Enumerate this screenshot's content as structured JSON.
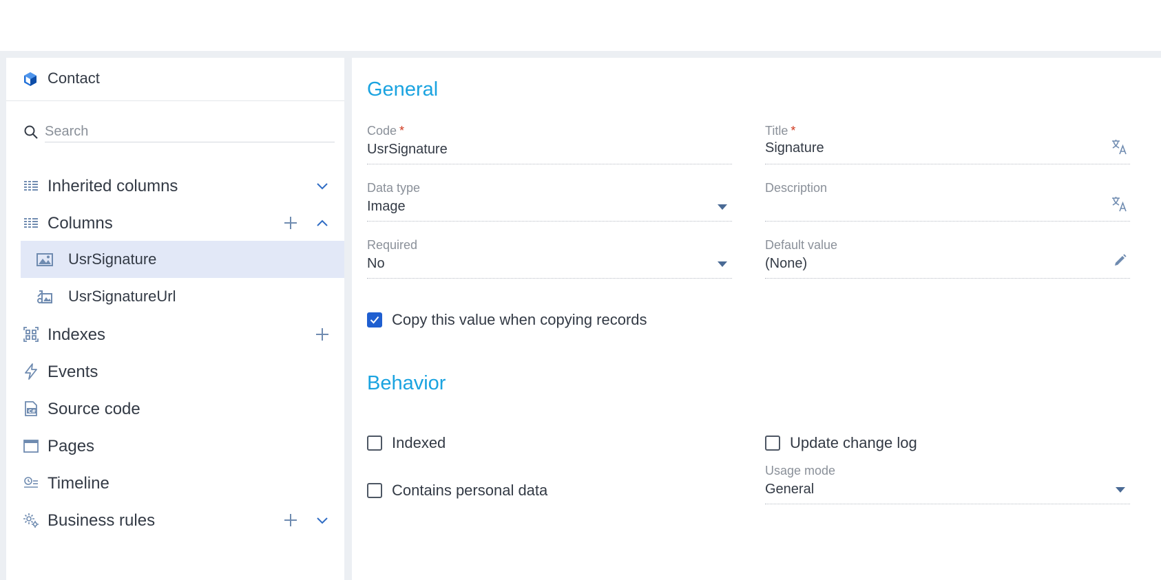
{
  "object": {
    "name": "Contact",
    "icon": "cube-icon"
  },
  "search": {
    "placeholder": "Search"
  },
  "nav": {
    "inherited_columns": "Inherited columns",
    "columns": "Columns",
    "column_items": [
      {
        "label": "UsrSignature",
        "icon": "image-icon",
        "selected": true
      },
      {
        "label": "UsrSignatureUrl",
        "icon": "image-link-icon",
        "selected": false
      }
    ],
    "indexes": "Indexes",
    "events": "Events",
    "source_code": "Source code",
    "pages": "Pages",
    "timeline": "Timeline",
    "business_rules": "Business rules"
  },
  "general": {
    "heading": "General",
    "code": {
      "label": "Code",
      "value": "UsrSignature",
      "required_mark": "*"
    },
    "title": {
      "label": "Title",
      "value": "Signature",
      "required_mark": "*"
    },
    "data_type": {
      "label": "Data type",
      "value": "Image"
    },
    "description": {
      "label": "Description",
      "value": ""
    },
    "required": {
      "label": "Required",
      "value": "No"
    },
    "default_value": {
      "label": "Default value",
      "value": "(None)"
    },
    "copy_value": {
      "label": "Copy this value when copying records",
      "checked": true
    }
  },
  "behavior": {
    "heading": "Behavior",
    "indexed": {
      "label": "Indexed",
      "checked": false
    },
    "update_change_log": {
      "label": "Update change log",
      "checked": false
    },
    "contains_personal_data": {
      "label": "Contains personal data",
      "checked": false
    },
    "usage_mode": {
      "label": "Usage mode",
      "value": "General"
    }
  },
  "colors": {
    "accent": "#1aa3e0",
    "selected_row": "#e2e8f7",
    "checkbox_checked": "#1f5fd0",
    "required": "#d0381e",
    "icon": "#6f8bb0",
    "chevron": "#2f6cc4"
  }
}
